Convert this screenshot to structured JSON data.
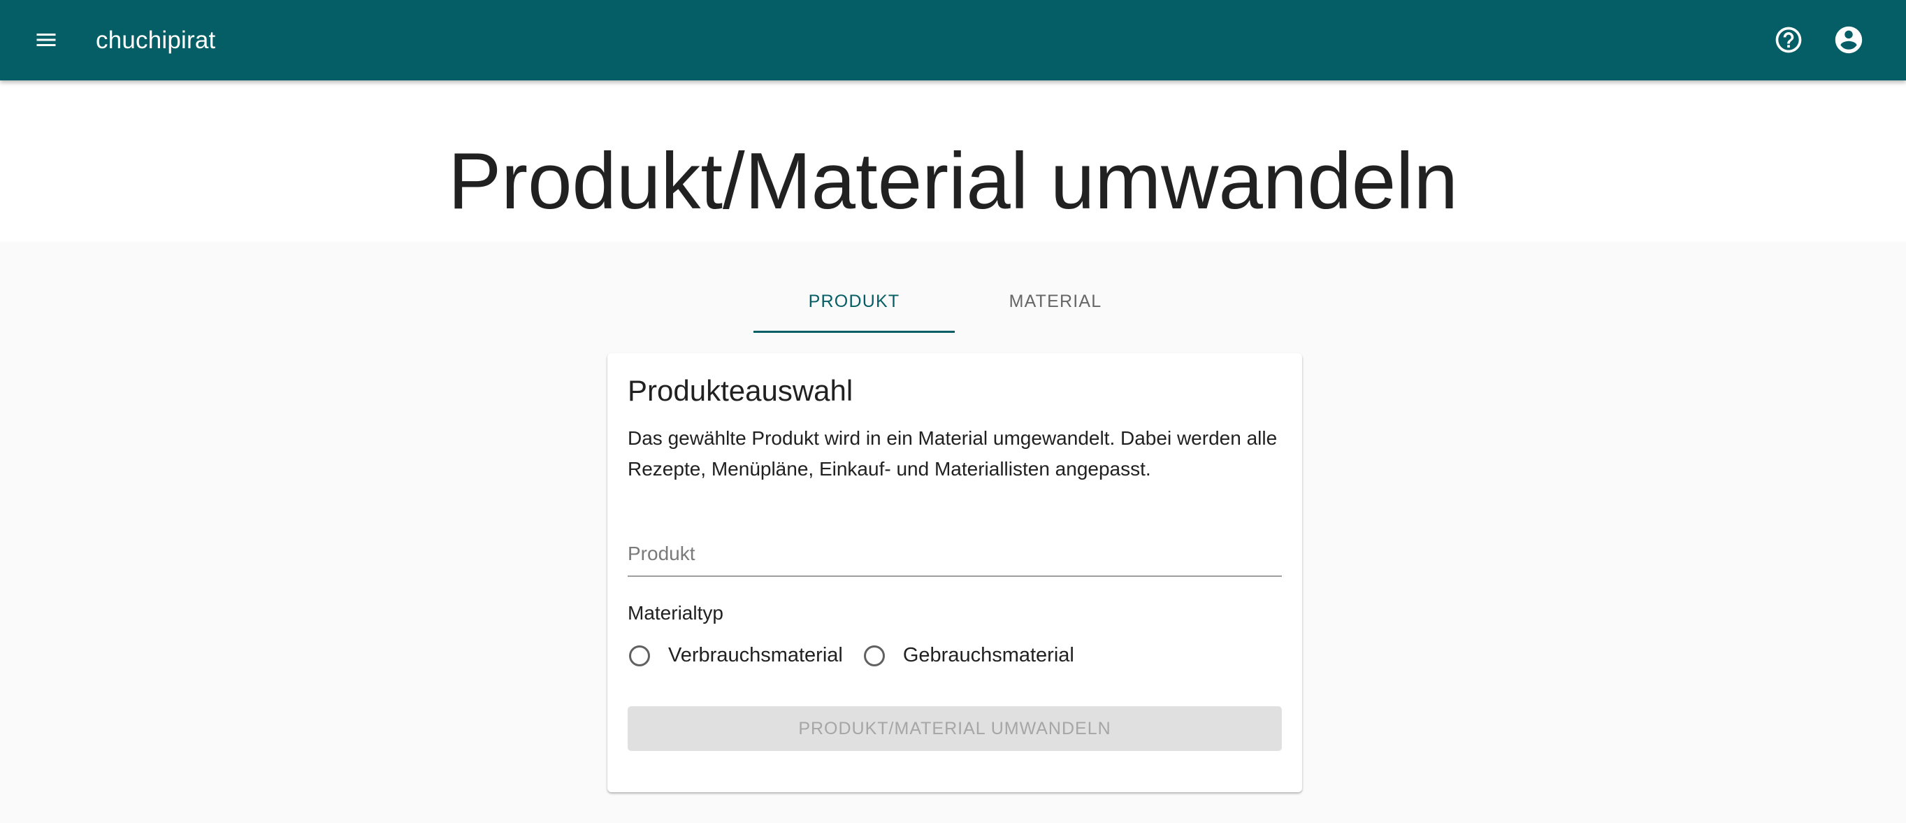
{
  "appbar": {
    "title": "chuchipirat",
    "icons": {
      "menu": "menu-icon",
      "help": "help-circle-icon",
      "account": "account-circle-icon"
    },
    "color": "#055e65"
  },
  "page": {
    "title": "Produkt/Material umwandeln"
  },
  "tabs": [
    {
      "label": "PRODUKT",
      "active": true
    },
    {
      "label": "MATERIAL",
      "active": false
    }
  ],
  "card": {
    "title": "Produkteauswahl",
    "description": "Das gewählte Produkt wird in ein Material umgewandelt. Dabei werden alle Rezepte, Menüpläne, Einkauf- und Materiallisten angepasst.",
    "product_field": {
      "placeholder": "Produkt",
      "value": ""
    },
    "material_type": {
      "legend": "Materialtyp",
      "options": [
        {
          "label": "Verbrauchsmaterial",
          "selected": false
        },
        {
          "label": "Gebrauchsmaterial",
          "selected": false
        }
      ]
    },
    "submit_label": "PRODUKT/MATERIAL UMWANDELN",
    "submit_disabled": true
  }
}
